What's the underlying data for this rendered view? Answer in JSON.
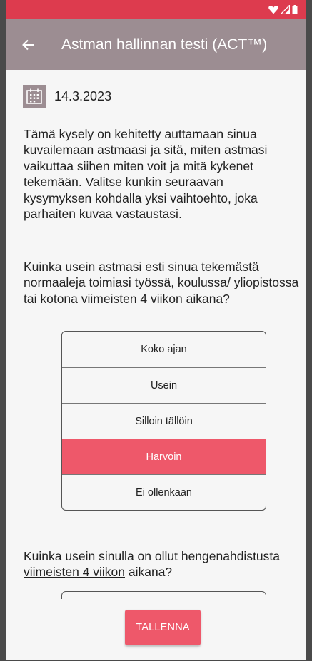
{
  "app": {
    "title": "Astman hallinnan testi (ACT™)",
    "back_icon": "arrow-left-icon"
  },
  "status_bar": {
    "icons": [
      "heart-icon",
      "signal-icon",
      "battery-icon"
    ],
    "color": "#dd3b4e"
  },
  "colors": {
    "app_bar": "#9c8d92",
    "accent": "#ee586a"
  },
  "date": {
    "icon": "calendar-icon",
    "value": "14.3.2023"
  },
  "intro": {
    "text": "Tämä kysely on kehitetty auttamaan sinua kuvailemaan astmaasi ja sitä, miten astmasi vaikuttaa siihen miten voit ja mitä kykenet tekemään. Valitse kunkin seuraavan kysymyksen kohdalla yksi vaihtoehto, joka parhaiten kuvaa vastaustasi."
  },
  "questions": [
    {
      "parts": [
        "Kuinka usein ",
        "astmasi",
        " esti sinua tekemästä normaaleja toimiasi työssä, koulussa/ yliopistossa tai kotona ",
        "viimeisten 4 viikon",
        " aikana?"
      ],
      "options": [
        "Koko ajan",
        "Usein",
        "Silloin tällöin",
        "Harvoin",
        "Ei ollenkaan"
      ],
      "selected": "Harvoin"
    },
    {
      "parts": [
        "Kuinka usein sinulla on ollut hengenahdistusta ",
        "viimeisten 4 viikon",
        " aikana?"
      ]
    }
  ],
  "footer": {
    "save_label": "TALLENNA"
  }
}
